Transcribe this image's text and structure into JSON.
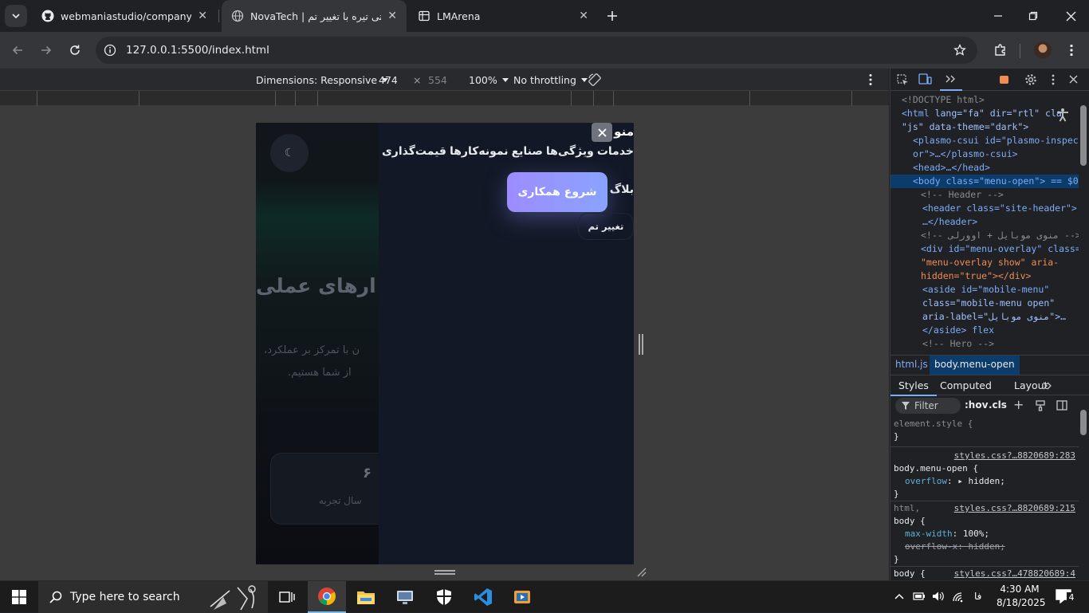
{
  "browser": {
    "tabs": [
      {
        "title": "webmaniastudio/company",
        "favicon": "github-icon",
        "active": false
      },
      {
        "title": "NovaTech | شرکتی تیره با تغییر تم",
        "favicon": "globe-icon",
        "active": true
      },
      {
        "title": "LMArena",
        "favicon": "table-icon",
        "active": false
      }
    ],
    "url": "127.0.0.1:5500/index.html"
  },
  "device_toolbar": {
    "dimensions_label": "Dimensions: Responsive",
    "width": "474",
    "times": "×",
    "height": "554",
    "zoom": "100%",
    "throttling": "No throttling"
  },
  "page": {
    "hero_heading_partial": "ارهای عملی",
    "hero_text_line1": "ن با تمرکز بر عملکرد،",
    "hero_text_line2": "از شما هستیم.",
    "stat_value": "۶",
    "stat_label": "سال تجربه",
    "theme_icon": "moon-icon"
  },
  "mobile_menu": {
    "title": "منو",
    "close_icon": "close-icon",
    "links_row1": [
      "خدمات",
      "ویژگی‌ها",
      "صنایع",
      "نمونه‌کارها",
      "قیمت‌گذاری"
    ],
    "blog_link": "بلاگ",
    "cta_button": "شروع همکاری",
    "theme_toggle": "تغییر تم"
  },
  "devtools": {
    "elements": [
      {
        "type": "doctype",
        "text": "<!DOCTYPE html>"
      },
      {
        "type": "open",
        "tag": "html",
        "attrs": "lang=\"fa\" dir=\"rtl\" cla"
      },
      {
        "type": "cont",
        "text": "\"js\" data-theme=\"dark\">"
      },
      {
        "type": "node",
        "text": "<plasmo-csui id=\"plasmo-inspect"
      },
      {
        "type": "cont",
        "text": "or\">…</plasmo-csui>"
      },
      {
        "type": "node",
        "text": "<head>…</head>"
      },
      {
        "type": "selected",
        "text": "<body class=\"menu-open\"> == $0"
      },
      {
        "type": "comment",
        "text": "<!-- Header -->"
      },
      {
        "type": "node",
        "text": "<header class=\"site-header\">"
      },
      {
        "type": "cont",
        "text": "…</header>"
      },
      {
        "type": "comment",
        "text": "<!-- منوی موبایل + اوورلی -->"
      },
      {
        "type": "node",
        "text": "<div id=\"menu-overlay\" class="
      },
      {
        "type": "cont",
        "text": "\"menu-overlay show\" aria-"
      },
      {
        "type": "cont",
        "text": "hidden=\"true\"></div>"
      },
      {
        "type": "node",
        "text": "<aside id=\"mobile-menu\""
      },
      {
        "type": "cont",
        "text": "class=\"mobile-menu open\""
      },
      {
        "type": "cont",
        "text": "aria-label=\"منوی موبایل\">…"
      },
      {
        "type": "cont",
        "text": "</aside> flex"
      },
      {
        "type": "comment",
        "text": "<!-- Hero -->"
      }
    ],
    "breadcrumb": [
      "html.js",
      "body.menu-open"
    ],
    "panel_tabs": [
      "Styles",
      "Computed",
      "Layout"
    ],
    "filter_placeholder": "Filter",
    "hov": ":hov",
    "cls": ".cls",
    "rules": [
      {
        "selector": "element.style {",
        "source": "",
        "decls": [],
        "close": "}"
      },
      {
        "selector": "body.menu-open {",
        "source": "styles.css?…8820689:283",
        "decls": [
          {
            "prop": "overflow",
            "value": "hidden;",
            "struck": false
          }
        ],
        "close": "}"
      },
      {
        "selector": "html,",
        "source": "styles.css?…8820689:215",
        "decls": [],
        "close": ""
      },
      {
        "selector": "body {",
        "source": "",
        "decls": [
          {
            "prop": "max-width",
            "value": "100%;",
            "struck": false
          },
          {
            "prop": "overflow-x",
            "value": "hidden;",
            "struck": true
          }
        ],
        "close": "}"
      },
      {
        "selector": "body {",
        "source": "styles.css?…478820689:4",
        "decls": [],
        "close": ""
      }
    ]
  },
  "taskbar": {
    "search_placeholder": "Type here to search",
    "time": "4:30 AM",
    "date": "8/18/2025",
    "lang": "فا",
    "notification_count": "4"
  }
}
